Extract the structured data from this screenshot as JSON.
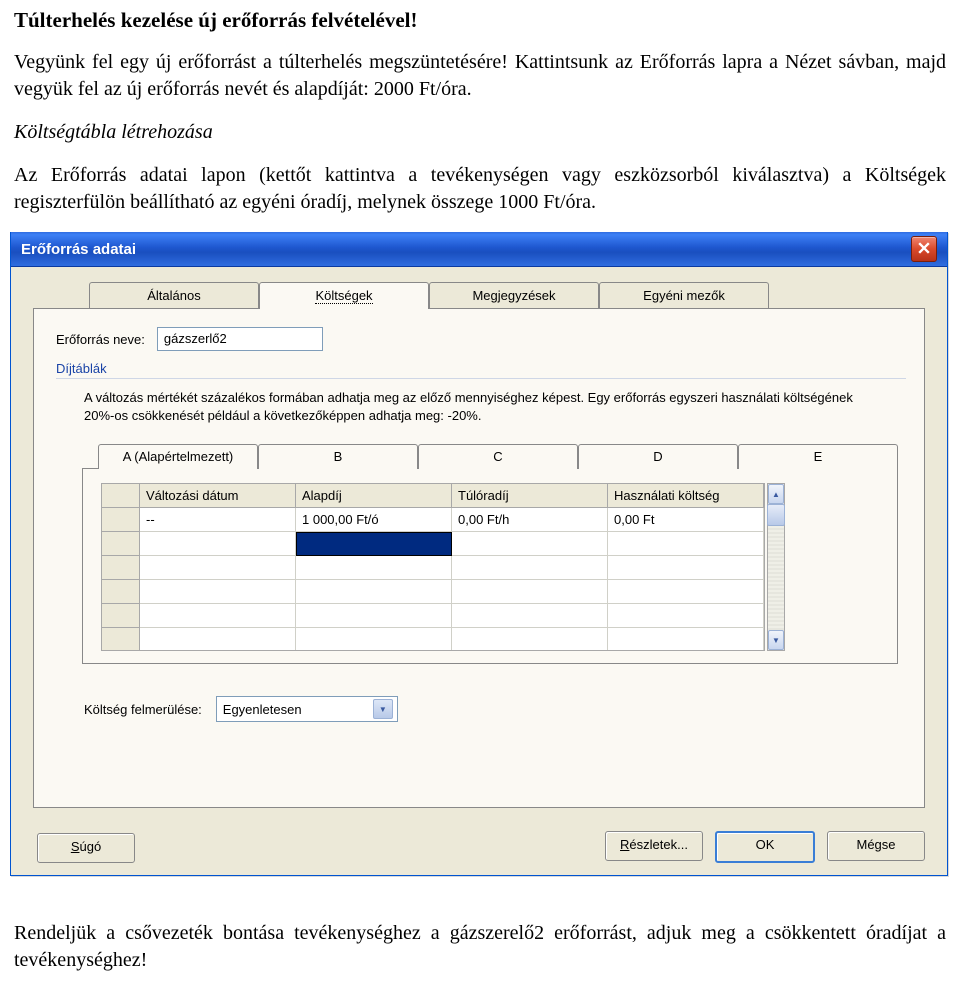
{
  "doc": {
    "heading": "Túlterhelés kezelése új erőforrás felvételével!",
    "p1": "Vegyünk fel egy új erőforrást a túlterhelés megszüntetésére! Kattintsunk az Erőforrás lapra a Nézet sávban, majd vegyük fel az új erőforrás nevét és alapdíját: 2000 Ft/óra.",
    "subsection": "Költségtábla létrehozása",
    "p2": "Az Erőforrás adatai lapon (kettőt kattintva a tevékenységen vagy eszközsorból kiválasztva) a Költségek regiszterfülön beállítható az egyéni óradíj, melynek összege 1000 Ft/óra.",
    "p3": "Rendeljük a csővezeték bontása tevékenységhez a gázszerelő2 erőforrást, adjuk meg a csökkentett óradíjat a tevékenységhez!"
  },
  "dialog": {
    "title": "Erőforrás adatai",
    "tabs": [
      "Általános",
      "Költségek",
      "Megjegyzések",
      "Egyéni mezők"
    ],
    "activeTab": 1,
    "nameLabel": "Erőforrás neve:",
    "nameValue": "gázszerlő2",
    "rateTablesLabel": "Díjtáblák",
    "rateDesc": "A változás mértékét százalékos formában adhatja meg az előző mennyiséghez képest. Egy erőforrás egyszeri használati költségének 20%-os csökkenését például a következőképpen adhatja meg: -20%.",
    "subtabs": [
      "A (Alapértelmezett)",
      "B",
      "C",
      "D",
      "E"
    ],
    "grid": {
      "headers": [
        "Változási dátum",
        "Alapdíj",
        "Túlóradíj",
        "Használati költség"
      ],
      "rows": [
        [
          "--",
          "1 000,00 Ft/ó",
          "0,00 Ft/h",
          "0,00 Ft"
        ],
        [
          "",
          "",
          "",
          ""
        ]
      ]
    },
    "emergLabel": "Költség felmerülése:",
    "emergValue": "Egyenletesen",
    "buttons": {
      "help": "Súgó",
      "details": "Részletek...",
      "ok": "OK",
      "cancel": "Mégse"
    }
  }
}
